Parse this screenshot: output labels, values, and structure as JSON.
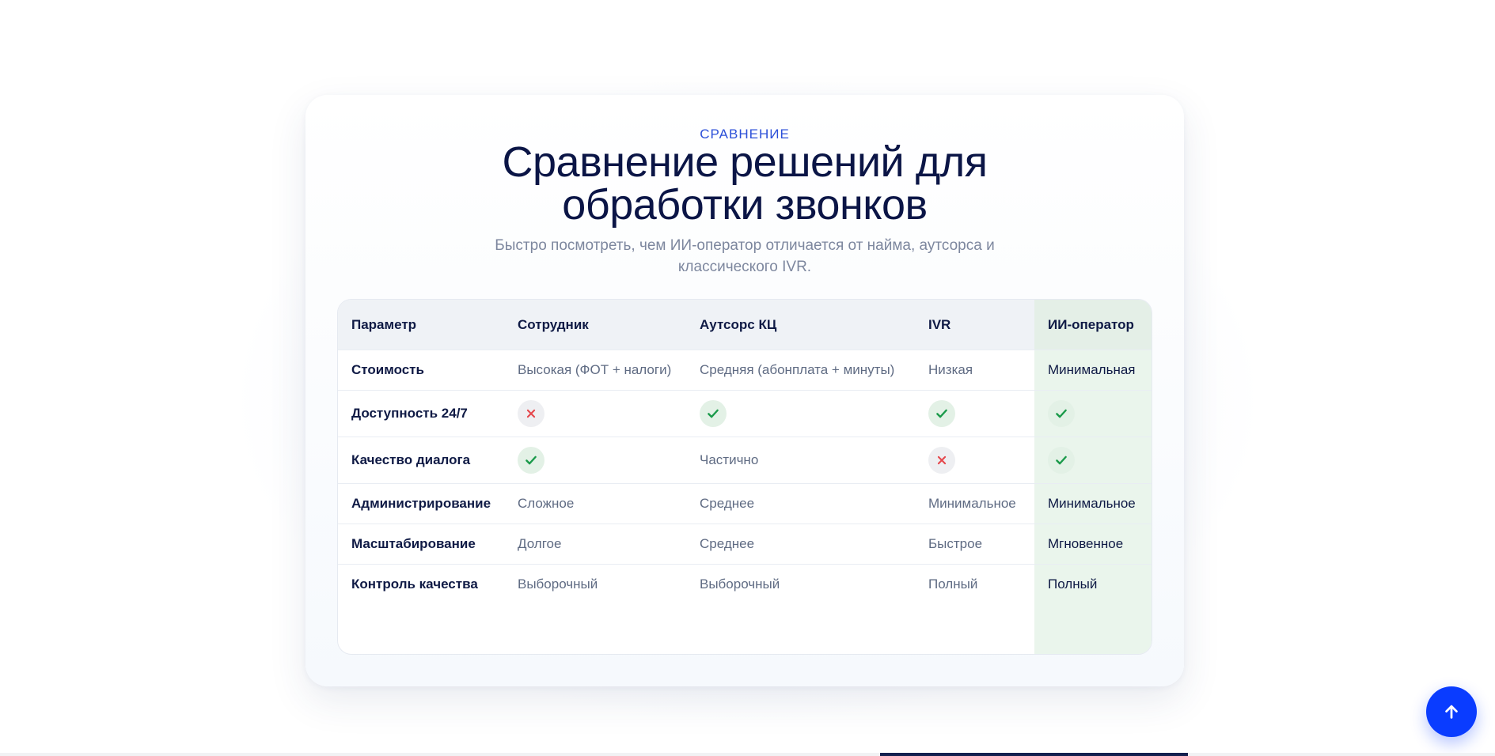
{
  "section": {
    "eyebrow": "СРАВНЕНИЕ",
    "title_line1": "Сравнение решений для",
    "title_line2": "обработки звонков",
    "subtitle": "Быстро посмотреть, чем ИИ-оператор отличается от найма, аутсорса и классического IVR."
  },
  "table": {
    "headers": [
      "Параметр",
      "Сотрудник",
      "Аутсорс КЦ",
      "IVR",
      "ИИ-оператор"
    ],
    "rows": [
      {
        "param": "Стоимость",
        "cells": [
          {
            "type": "text",
            "value": "Высокая (ФОТ + налоги)"
          },
          {
            "type": "text",
            "value": "Средняя (абонплата + минуты)"
          },
          {
            "type": "text",
            "value": "Низкая"
          },
          {
            "type": "text",
            "value": "Минимальная"
          }
        ]
      },
      {
        "param": "Доступность 24/7",
        "cells": [
          {
            "type": "no",
            "icon": "cross-icon"
          },
          {
            "type": "yes",
            "icon": "check-icon"
          },
          {
            "type": "yes",
            "icon": "check-icon"
          },
          {
            "type": "yes",
            "icon": "check-icon"
          }
        ]
      },
      {
        "param": "Качество диалога",
        "cells": [
          {
            "type": "yes",
            "icon": "check-icon"
          },
          {
            "type": "text",
            "value": "Частично"
          },
          {
            "type": "no",
            "icon": "cross-icon"
          },
          {
            "type": "yes",
            "icon": "check-icon"
          }
        ]
      },
      {
        "param": "Администрирование",
        "cells": [
          {
            "type": "text",
            "value": "Сложное"
          },
          {
            "type": "text",
            "value": "Среднее"
          },
          {
            "type": "text",
            "value": "Минимальное"
          },
          {
            "type": "text",
            "value": "Минимальное"
          }
        ]
      },
      {
        "param": "Масштабирование",
        "cells": [
          {
            "type": "text",
            "value": "Долгое"
          },
          {
            "type": "text",
            "value": "Среднее"
          },
          {
            "type": "text",
            "value": "Быстрое"
          },
          {
            "type": "text",
            "value": "Мгновенное"
          }
        ]
      },
      {
        "param": "Контроль качества",
        "cells": [
          {
            "type": "text",
            "value": "Выборочный"
          },
          {
            "type": "text",
            "value": "Выборочный"
          },
          {
            "type": "text",
            "value": "Полный"
          },
          {
            "type": "text",
            "value": "Полный"
          }
        ]
      }
    ]
  },
  "colors": {
    "accent": "#0a3cff",
    "title": "#0b1546",
    "eyebrow": "#2b4fd8",
    "check": "#1a9a4a",
    "cross": "#e5484d",
    "highlight_column": "#eaf5ec"
  },
  "scroll_top": {
    "icon": "arrow-up-icon"
  }
}
